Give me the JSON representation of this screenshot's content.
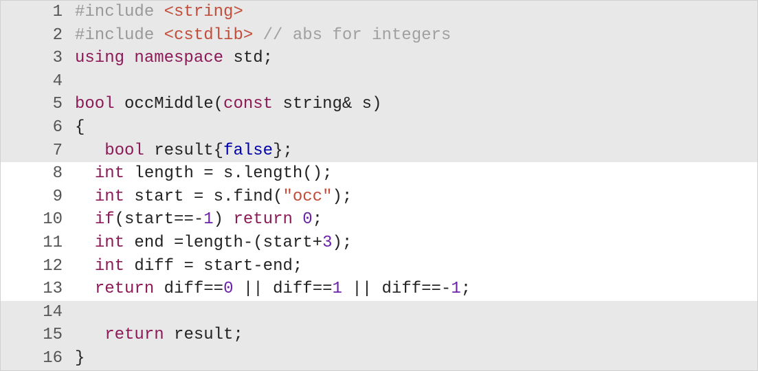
{
  "code": {
    "lines": [
      {
        "num": "1",
        "hl": false,
        "indent": "",
        "tokens": [
          {
            "cls": "tok-pp",
            "t": "#include"
          },
          {
            "cls": "",
            "t": " "
          },
          {
            "cls": "tok-inc",
            "t": "<string>"
          }
        ]
      },
      {
        "num": "2",
        "hl": false,
        "indent": "",
        "tokens": [
          {
            "cls": "tok-pp",
            "t": "#include"
          },
          {
            "cls": "",
            "t": " "
          },
          {
            "cls": "tok-inc",
            "t": "<cstdlib>"
          },
          {
            "cls": "",
            "t": " "
          },
          {
            "cls": "tok-cm",
            "t": "// abs for integers"
          }
        ]
      },
      {
        "num": "3",
        "hl": false,
        "indent": "",
        "tokens": [
          {
            "cls": "tok-kw",
            "t": "using"
          },
          {
            "cls": "",
            "t": " "
          },
          {
            "cls": "tok-kw",
            "t": "namespace"
          },
          {
            "cls": "",
            "t": " std;"
          }
        ]
      },
      {
        "num": "4",
        "hl": false,
        "indent": "",
        "tokens": []
      },
      {
        "num": "5",
        "hl": false,
        "indent": "",
        "tokens": [
          {
            "cls": "tok-kw",
            "t": "bool"
          },
          {
            "cls": "",
            "t": " occMiddle("
          },
          {
            "cls": "tok-kw",
            "t": "const"
          },
          {
            "cls": "",
            "t": " string& s)"
          }
        ]
      },
      {
        "num": "6",
        "hl": false,
        "indent": "",
        "tokens": [
          {
            "cls": "",
            "t": "{"
          }
        ]
      },
      {
        "num": "7",
        "hl": false,
        "indent": "   ",
        "tokens": [
          {
            "cls": "tok-kw",
            "t": "bool"
          },
          {
            "cls": "",
            "t": " result{"
          },
          {
            "cls": "tok-kw2",
            "t": "false"
          },
          {
            "cls": "",
            "t": "};"
          }
        ]
      },
      {
        "num": "8",
        "hl": true,
        "indent": "  ",
        "tokens": [
          {
            "cls": "tok-kw",
            "t": "int"
          },
          {
            "cls": "",
            "t": " length = s.length();"
          }
        ]
      },
      {
        "num": "9",
        "hl": true,
        "indent": "  ",
        "tokens": [
          {
            "cls": "tok-kw",
            "t": "int"
          },
          {
            "cls": "",
            "t": " start = s.find("
          },
          {
            "cls": "tok-str",
            "t": "\"occ\""
          },
          {
            "cls": "",
            "t": ");"
          }
        ]
      },
      {
        "num": "10",
        "hl": true,
        "indent": "  ",
        "tokens": [
          {
            "cls": "tok-kw",
            "t": "if"
          },
          {
            "cls": "",
            "t": "(start==-"
          },
          {
            "cls": "tok-num",
            "t": "1"
          },
          {
            "cls": "",
            "t": ") "
          },
          {
            "cls": "tok-kw",
            "t": "return"
          },
          {
            "cls": "",
            "t": " "
          },
          {
            "cls": "tok-num",
            "t": "0"
          },
          {
            "cls": "",
            "t": ";"
          }
        ]
      },
      {
        "num": "11",
        "hl": true,
        "indent": "  ",
        "tokens": [
          {
            "cls": "tok-kw",
            "t": "int"
          },
          {
            "cls": "",
            "t": " end =length-(start+"
          },
          {
            "cls": "tok-num",
            "t": "3"
          },
          {
            "cls": "",
            "t": ");"
          }
        ]
      },
      {
        "num": "12",
        "hl": true,
        "indent": "  ",
        "tokens": [
          {
            "cls": "tok-kw",
            "t": "int"
          },
          {
            "cls": "",
            "t": " diff = start-end;"
          }
        ]
      },
      {
        "num": "13",
        "hl": true,
        "indent": "  ",
        "tokens": [
          {
            "cls": "tok-kw",
            "t": "return"
          },
          {
            "cls": "",
            "t": " diff=="
          },
          {
            "cls": "tok-num",
            "t": "0"
          },
          {
            "cls": "",
            "t": " || diff=="
          },
          {
            "cls": "tok-num",
            "t": "1"
          },
          {
            "cls": "",
            "t": " || diff==-"
          },
          {
            "cls": "tok-num",
            "t": "1"
          },
          {
            "cls": "",
            "t": ";"
          }
        ]
      },
      {
        "num": "14",
        "hl": false,
        "indent": "",
        "tokens": []
      },
      {
        "num": "15",
        "hl": false,
        "indent": "   ",
        "tokens": [
          {
            "cls": "tok-kw",
            "t": "return"
          },
          {
            "cls": "",
            "t": " result;"
          }
        ]
      },
      {
        "num": "16",
        "hl": false,
        "indent": "",
        "tokens": [
          {
            "cls": "",
            "t": "}"
          }
        ]
      }
    ]
  }
}
